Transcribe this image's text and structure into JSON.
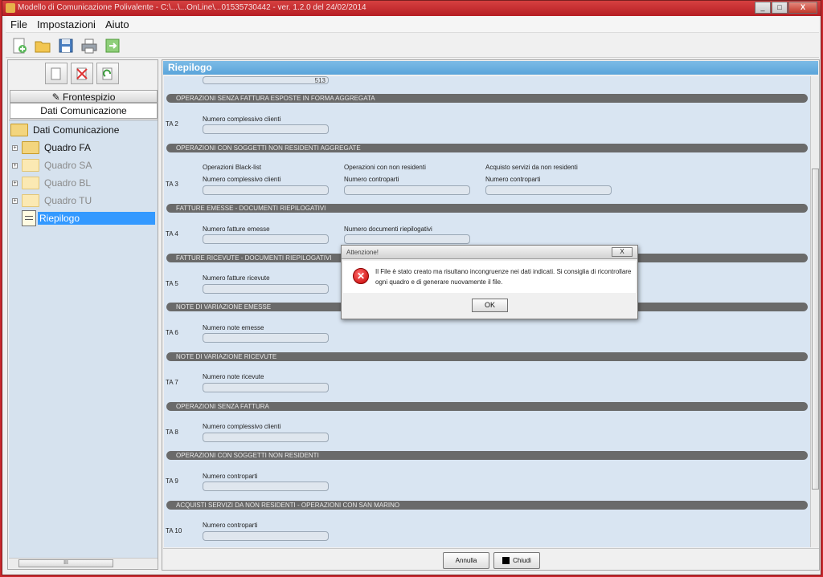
{
  "window": {
    "title": "Modello di Comunicazione Polivalente - C:\\...\\...OnLine\\...01535730442 - ver. 1.2.0 del 24/02/2014",
    "controls": [
      "_",
      "□",
      "X"
    ]
  },
  "menu": [
    "File",
    "Impostazioni",
    "Aiuto"
  ],
  "toolbar_icons": [
    "new-icon",
    "open-icon",
    "save-icon",
    "print-icon",
    "export-icon"
  ],
  "left_panel": {
    "tab_fronte": "Frontespizio",
    "tab_dati": "Dati Comunicazione",
    "tree": {
      "root": "Dati Comunicazione",
      "items": [
        {
          "label": "Quadro FA",
          "dim": false
        },
        {
          "label": "Quadro SA",
          "dim": true
        },
        {
          "label": "Quadro BL",
          "dim": true
        },
        {
          "label": "Quadro TU",
          "dim": true
        },
        {
          "label": "Riepilogo",
          "selected": true
        }
      ]
    },
    "scroll_glyph": "III"
  },
  "right_panel": {
    "header": "Riepilogo",
    "top_value": "513",
    "sections": [
      {
        "title": "OPERAZIONI SENZA FATTURA ESPOSTE IN FORMA AGGREGATA",
        "code": "TA 2",
        "fields": [
          {
            "label": "Numero complessivo clienti"
          }
        ]
      },
      {
        "title": "OPERAZIONI CON SOGGETTI NON RESIDENTI AGGREGATE",
        "code": "TA 3",
        "fields": [
          {
            "group": "Operazioni Black-list",
            "label": "Numero complessivo clienti"
          },
          {
            "group": "Operazioni con non residenti",
            "label": "Numero controparti"
          },
          {
            "group": "Acquisto servizi da non residenti",
            "label": "Numero controparti"
          }
        ]
      },
      {
        "title": "FATTURE EMESSE - DOCUMENTI RIEPILOGATIVI",
        "code": "TA 4",
        "fields": [
          {
            "label": "Numero fatture emesse"
          },
          {
            "label": "Numero documenti riepilogativi"
          }
        ]
      },
      {
        "title": "FATTURE RICEVUTE - DOCUMENTI RIEPILOGATIVI",
        "code": "TA 5",
        "fields": [
          {
            "label": "Numero fatture ricevute"
          }
        ]
      },
      {
        "title": "NOTE DI VARIAZIONE EMESSE",
        "code": "TA 6",
        "fields": [
          {
            "label": "Numero note emesse"
          }
        ]
      },
      {
        "title": "NOTE DI VARIAZIONE RICEVUTE",
        "code": "TA 7",
        "fields": [
          {
            "label": "Numero note ricevute"
          }
        ]
      },
      {
        "title": "OPERAZIONI SENZA FATTURA",
        "code": "TA 8",
        "fields": [
          {
            "label": "Numero complessivo clienti"
          }
        ]
      },
      {
        "title": "OPERAZIONI CON SOGGETTI NON RESIDENTI",
        "code": "TA 9",
        "fields": [
          {
            "label": "Numero controparti"
          }
        ]
      },
      {
        "title": "ACQUISTI SERVIZI DA NON RESIDENTI - OPERAZIONI CON SAN MARINO",
        "code": "TA 10",
        "fields": [
          {
            "label": "Numero controparti"
          }
        ]
      }
    ],
    "buttons": {
      "cancel": "Annulla",
      "close": "Chiudi"
    }
  },
  "dialog": {
    "title": "Attenzione!",
    "close": "X",
    "message": "Il File è stato creato ma risultano incongruenze nei dati indicati. Si consiglia di ricontrollare ogni quadro e di generare nuovamente il file.",
    "ok": "OK"
  }
}
